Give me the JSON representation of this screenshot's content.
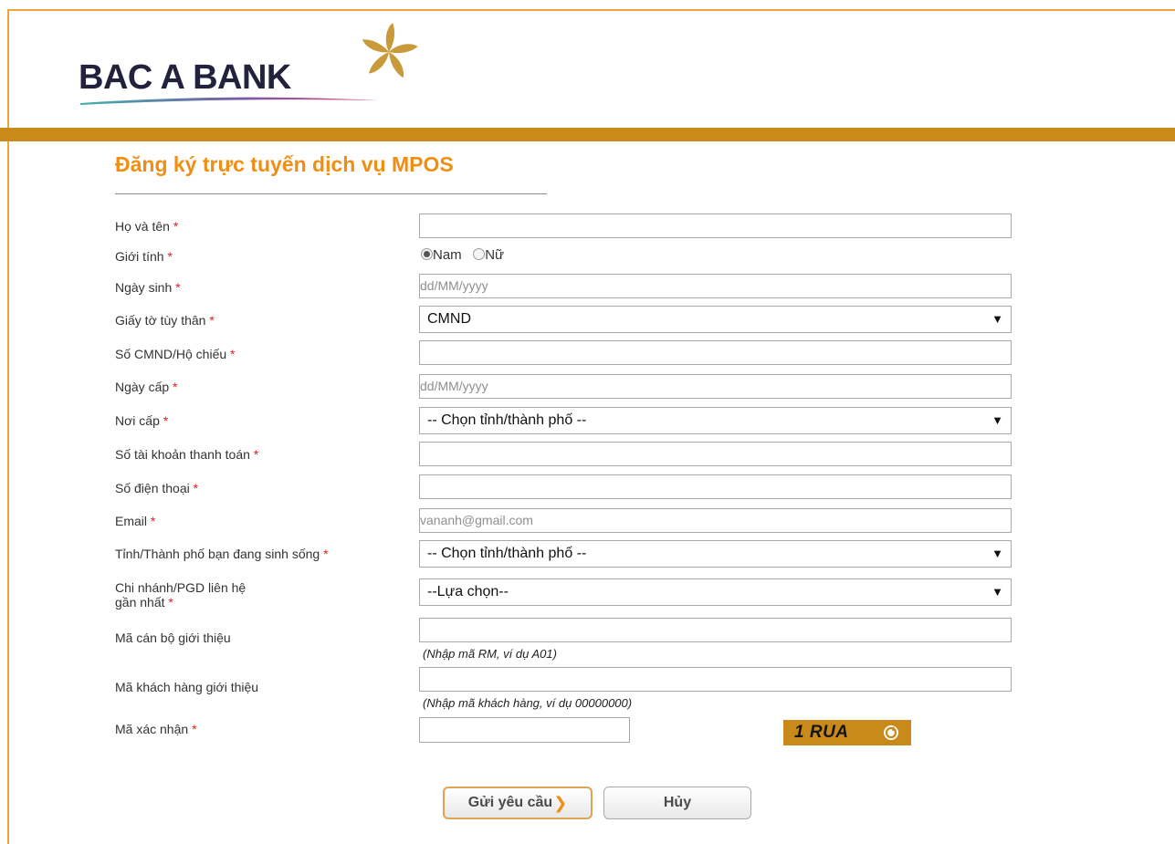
{
  "brand": {
    "name": "BAC A BANK",
    "accent": "#c98a1a",
    "title_color": "#f08e14",
    "required_color": "#e02020"
  },
  "page": {
    "title": "Đăng ký trực tuyến dịch vụ MPOS"
  },
  "form": {
    "required_mark": "*",
    "full_name": {
      "label": "Họ và tên",
      "value": ""
    },
    "gender": {
      "label": "Giới tính",
      "options": [
        "Nam",
        "Nữ"
      ],
      "selected": "Nam"
    },
    "dob": {
      "label": "Ngày sinh",
      "placeholder": "dd/MM/yyyy"
    },
    "id_type": {
      "label": "Giấy tờ tùy thân",
      "selected": "CMND"
    },
    "id_number": {
      "label": "Số CMND/Hộ chiếu",
      "value": ""
    },
    "issue_date": {
      "label": "Ngày cấp",
      "placeholder": "dd/MM/yyyy"
    },
    "issue_place": {
      "label": "Nơi cấp",
      "selected": "-- Chọn tỉnh/thành phố --"
    },
    "account_number": {
      "label": "Số tài khoản thanh toán",
      "value": ""
    },
    "phone": {
      "label": "Số điện thoại",
      "value": ""
    },
    "email": {
      "label": "Email",
      "placeholder": "vananh@gmail.com"
    },
    "living_city": {
      "label": "Tỉnh/Thành phố bạn đang sinh sống",
      "selected": "-- Chọn tỉnh/thành phố --"
    },
    "branch": {
      "label_line1": "Chi nhánh/PGD liên hệ",
      "label_line2": "gần nhất",
      "selected": "--Lựa chọn--"
    },
    "staff_code": {
      "label": "Mã cán bộ giới thiệu",
      "hint": "(Nhập mã RM, ví dụ A01)"
    },
    "customer_code": {
      "label": "Mã khách hàng giới thiệu",
      "hint": "(Nhập mã khách hàng, ví dụ 00000000)"
    },
    "captcha": {
      "label": "Mã xác nhận",
      "text": "1 RUA"
    }
  },
  "buttons": {
    "submit": "Gửi yêu cầu",
    "cancel": "Hủy"
  },
  "icons": {
    "dropdown": "chevron-down-icon",
    "refresh": "refresh-icon",
    "submit_arrow": "chevron-right-icon"
  }
}
